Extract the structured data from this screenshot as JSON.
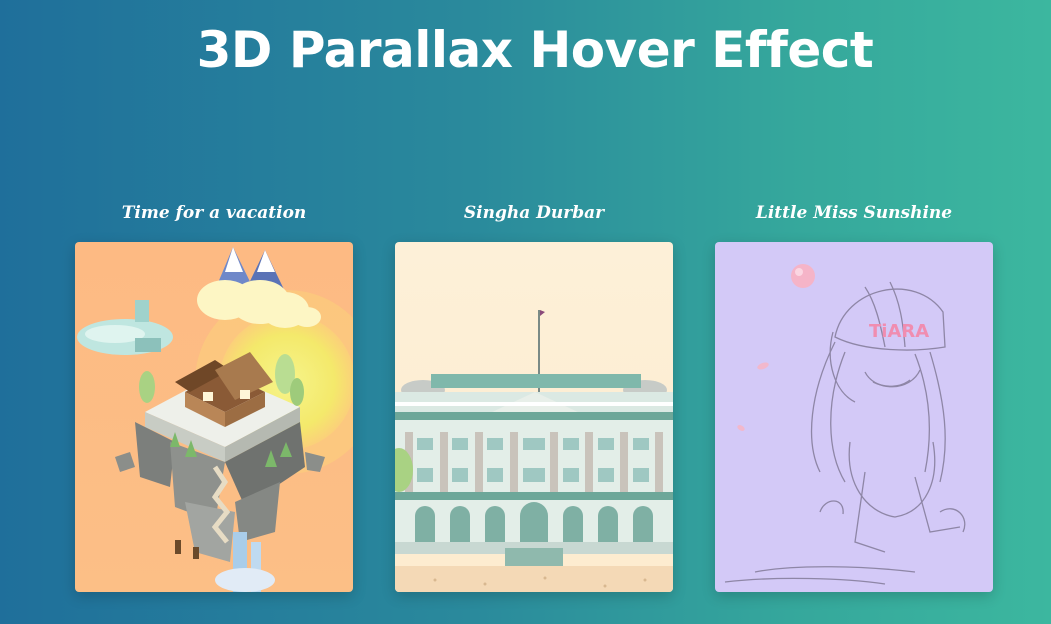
{
  "page": {
    "title": "3D Parallax Hover Effect"
  },
  "cards": [
    {
      "title": "Time for a vacation",
      "image_icon": "floating-island-illustration",
      "accent": "#fbbf85"
    },
    {
      "title": "Singha Durbar",
      "image_icon": "palace-illustration",
      "accent": "#fdf1d9"
    },
    {
      "title": "Little Miss Sunshine",
      "image_icon": "character-sketch-illustration",
      "accent": "#d3c8f7"
    }
  ],
  "illustrations": {
    "sketch_label": "TiARA"
  }
}
